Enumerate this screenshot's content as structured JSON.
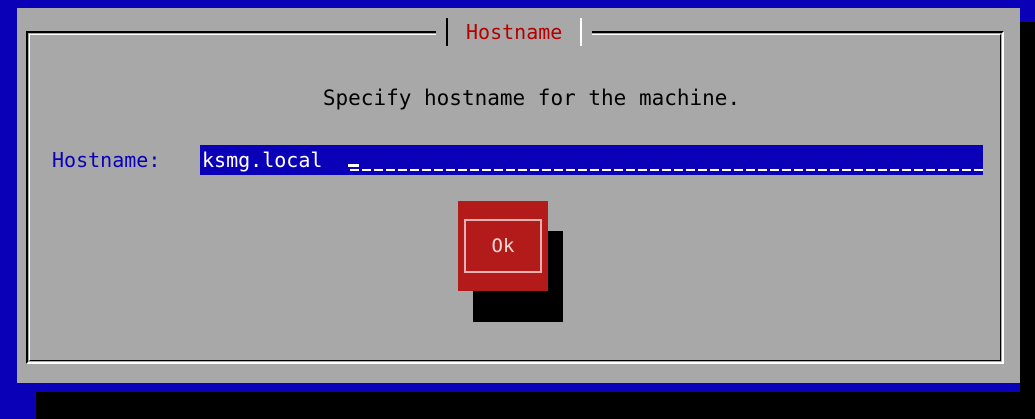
{
  "dialog": {
    "title": "Hostname",
    "prompt": "Specify hostname for the machine."
  },
  "field": {
    "label": "Hostname:",
    "value": "ksmg.local"
  },
  "buttons": {
    "ok_label": "Ok"
  },
  "colors": {
    "background": "#0a00b8",
    "dialog": "#a8a8a8",
    "title": "#b30000",
    "button": "#b31b1b",
    "input_background": "#0a00b8"
  }
}
